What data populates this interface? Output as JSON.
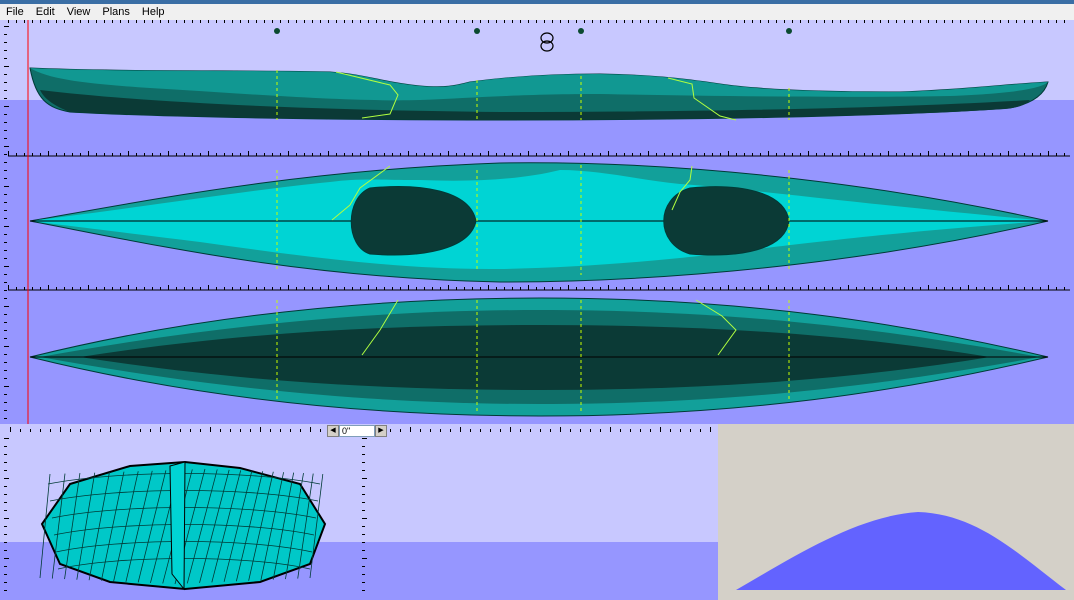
{
  "menu": {
    "file": "File",
    "edit": "Edit",
    "view": "View",
    "plans": "Plans",
    "help": "Help"
  },
  "angle_spinner": {
    "value": "0\"",
    "left_glyph": "◀",
    "right_glyph": "▶"
  },
  "colors": {
    "workspace_bg": "#c8c8ff",
    "water": "#9696ff",
    "hull_dark": "#0b3a36",
    "hull_mid": "#0f6e68",
    "hull_teal": "#12a09a",
    "deck_light": "#00d4d4",
    "curve_fill": "#6363ff",
    "grid_line": "#c8ff00",
    "cursor_line": "#ff0000",
    "bulkhead": "#b0ff40"
  },
  "icons": {
    "hatch_marker": "figure-eight-icon",
    "station_marker": "station-dot-icon"
  }
}
